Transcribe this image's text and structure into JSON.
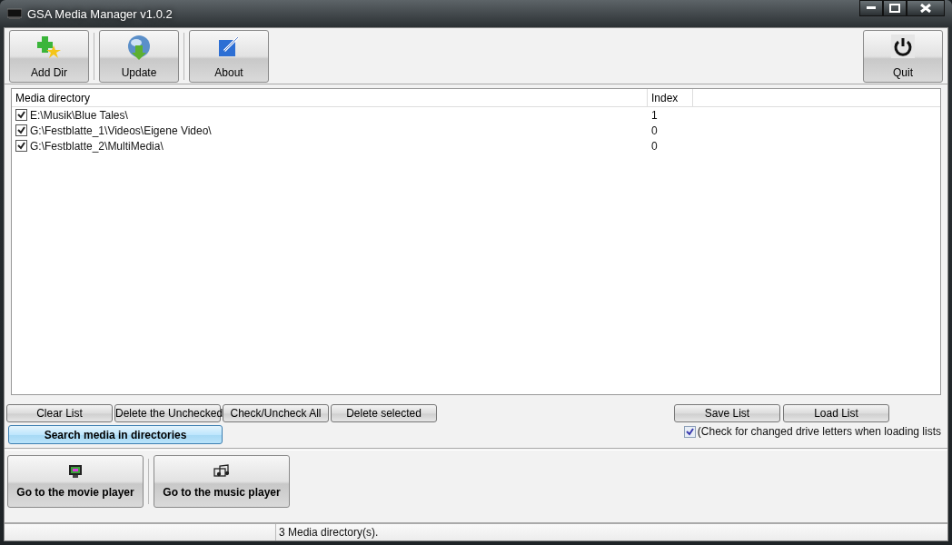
{
  "window": {
    "title": "GSA Media Manager v1.0.2"
  },
  "toolbar": [
    {
      "label": "Add Dir",
      "kind": "add"
    },
    {
      "label": "Update",
      "kind": "update"
    },
    {
      "label": "About",
      "kind": "about"
    }
  ],
  "quit_button": {
    "label": "Quit"
  },
  "table": {
    "columns": [
      "Media directory",
      "Index"
    ],
    "rows": [
      {
        "path": "E:\\Musik\\Blue Tales\\",
        "index": "1",
        "checked": true
      },
      {
        "path": "G:\\Festblatte_1\\Videos\\Eigene Video\\",
        "index": "0",
        "checked": true
      },
      {
        "path": "G:\\Festblatte_2\\MultiMedia\\",
        "index": "0",
        "checked": true
      }
    ]
  },
  "list_buttons": [
    "Clear List",
    "Delete the Unchecked",
    "Check/Uncheck All",
    "Delete selected"
  ],
  "file_buttons": [
    "Save List",
    "Load List"
  ],
  "search_button": "Search media in directories",
  "drive_check": {
    "label": "(Check for changed drive letters when loading lists",
    "checked": true
  },
  "players": [
    {
      "label": "Go to the movie player",
      "kind": "movie"
    },
    {
      "label": "Go to the music player",
      "kind": "music"
    }
  ],
  "status_bar": {
    "text": "3 Media directory(s)."
  }
}
